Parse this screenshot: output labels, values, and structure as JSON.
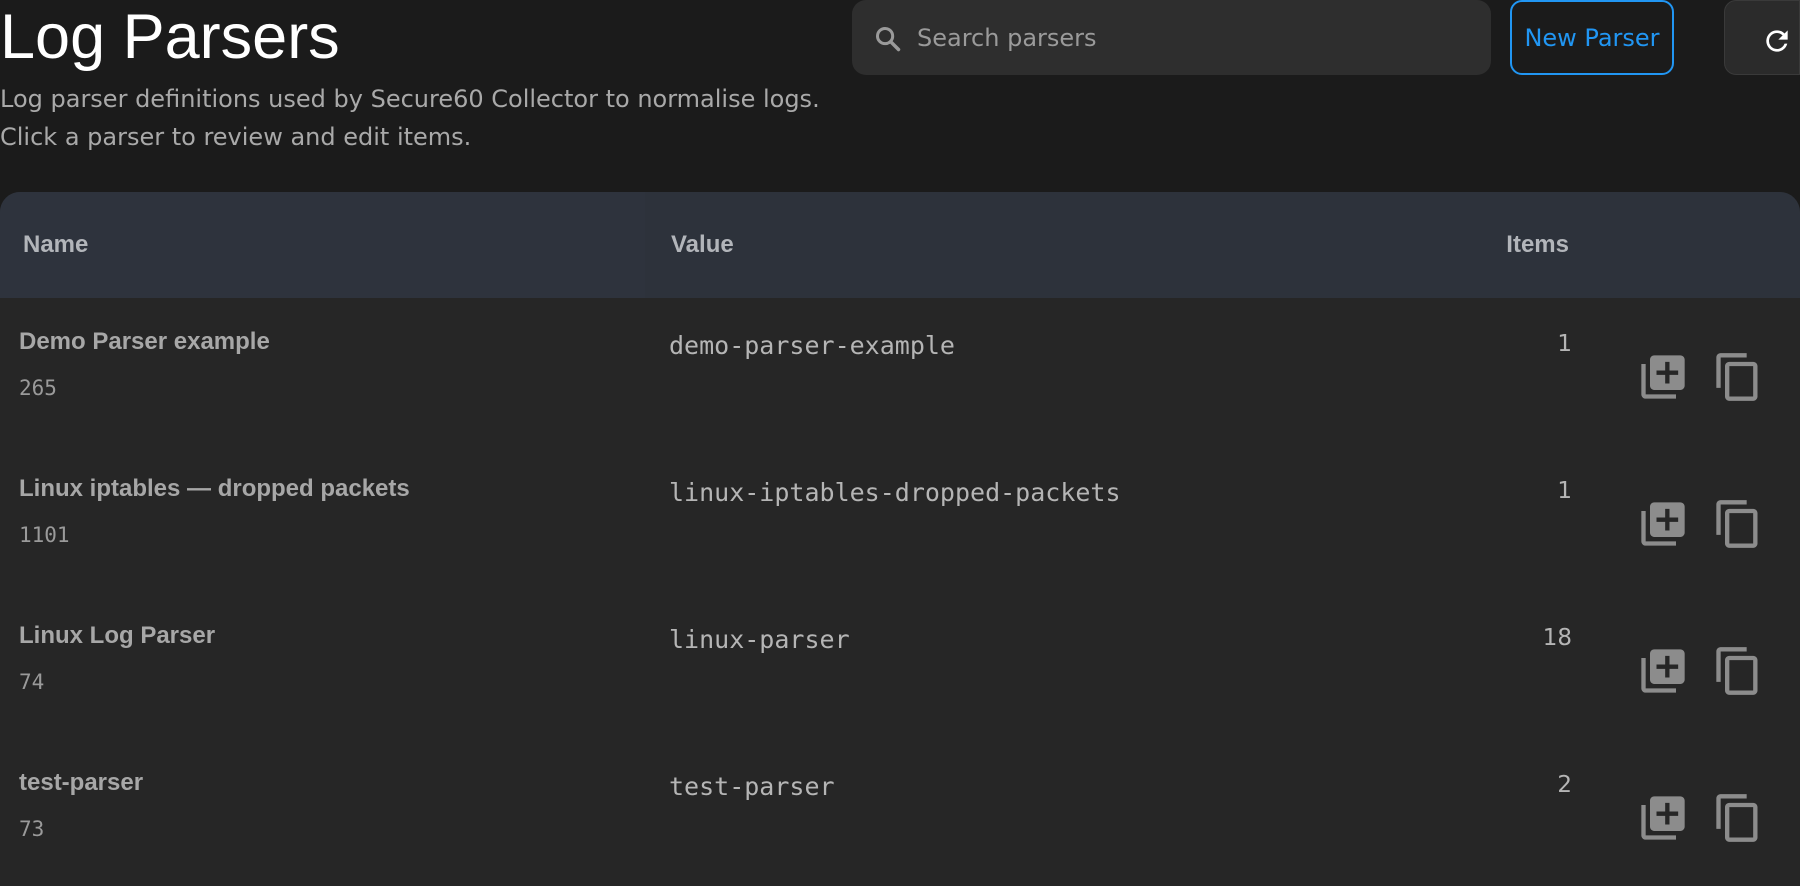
{
  "page": {
    "title": "Log Parsers",
    "description_lines": [
      "Log parser definitions used by Secure60 Collector to normalise logs.",
      "Click a parser to review and edit items."
    ]
  },
  "search": {
    "placeholder": "Search parsers",
    "value": "",
    "icon": "search-icon"
  },
  "toolbar": {
    "new_parser_label": "New Parser",
    "refresh_icon": "refresh-icon"
  },
  "table": {
    "columns": {
      "name": "Name",
      "value": "Value",
      "items": "Items"
    },
    "rows": [
      {
        "name": "Demo Parser example",
        "id": "265",
        "value": "demo-parser-example",
        "items": "1"
      },
      {
        "name": "Linux iptables — dropped packets",
        "id": "1101",
        "value": "linux-iptables-dropped-packets",
        "items": "1"
      },
      {
        "name": "Linux Log Parser",
        "id": "74",
        "value": "linux-parser",
        "items": "18"
      },
      {
        "name": "test-parser",
        "id": "73",
        "value": "test-parser",
        "items": "2"
      }
    ],
    "row_actions": [
      "add-item-icon",
      "duplicate-icon"
    ]
  },
  "colors": {
    "background": "#1b1b1b",
    "accent": "#2196f3",
    "header_bg": "#2d323b",
    "row_bg": "#262626"
  }
}
